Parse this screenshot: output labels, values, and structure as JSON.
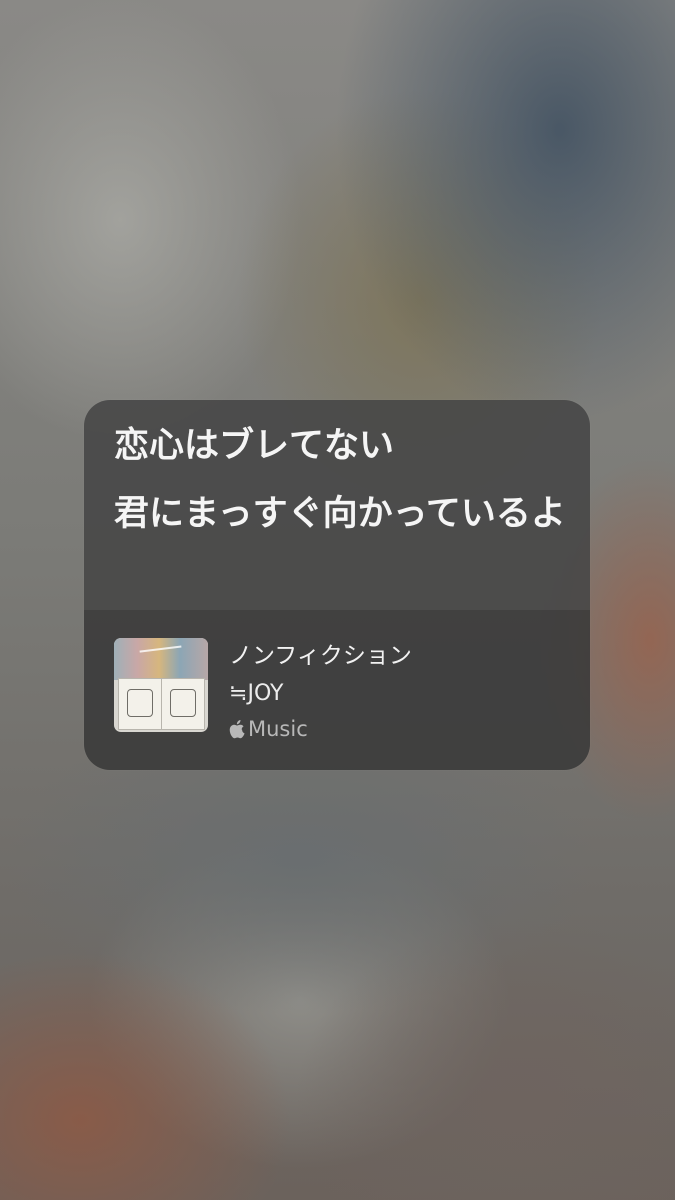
{
  "widget": {
    "lyrics": [
      "恋心はブレてない",
      "君にまっすぐ向かっているよ"
    ],
    "song": {
      "title": "ノンフィクション",
      "artist": "≒JOY",
      "service_label": "Music",
      "icon": "apple-icon"
    }
  }
}
